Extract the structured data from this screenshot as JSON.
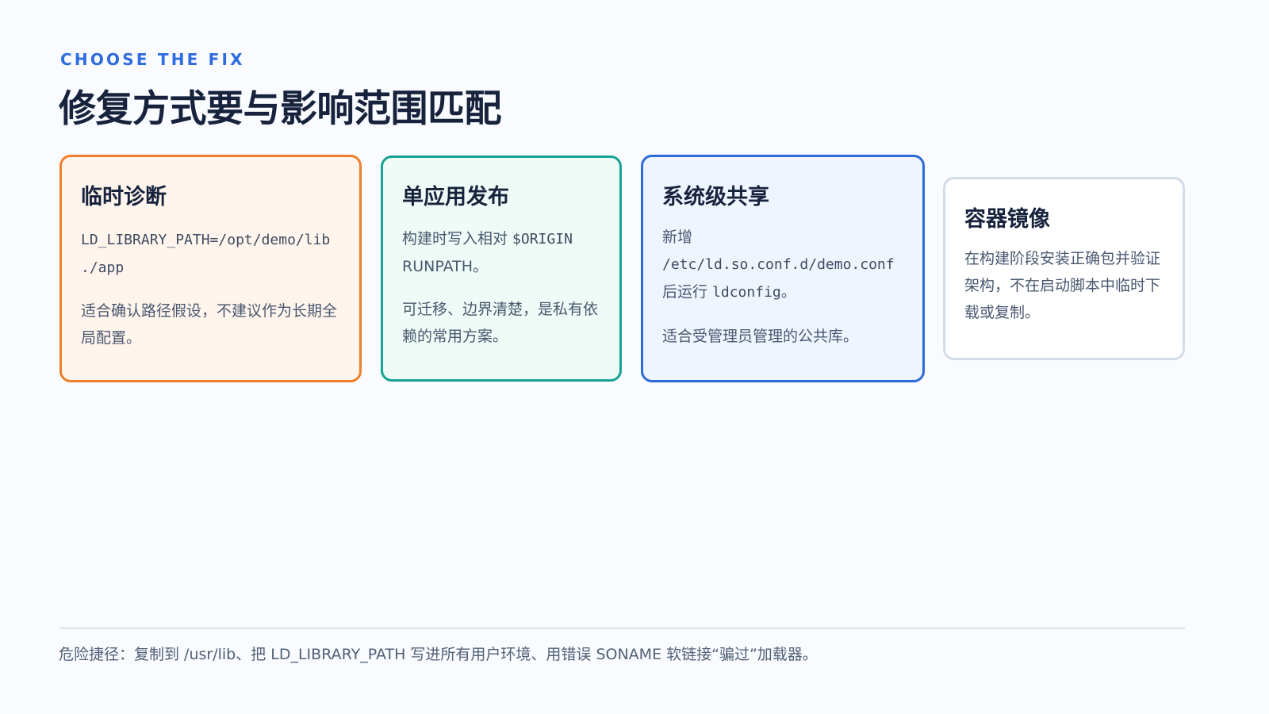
{
  "header": {
    "eyebrow": "CHOOSE THE FIX",
    "title": "修复方式要与影响范围匹配"
  },
  "cards": [
    {
      "title": "临时诊断",
      "cmd_line1": "LD_LIBRARY_PATH=/opt/demo/lib",
      "cmd_line2": "./app",
      "desc": "适合确认路径假设，不建议作为长期全局配置。",
      "accent": "#ef7f2a",
      "background": "#fff5ec"
    },
    {
      "title": "单应用发布",
      "desc1_prefix": "构建时写入相对 ",
      "desc1_code": "$ORIGIN",
      "desc1_suffix": " RUNPATH。",
      "desc2": "可迁移、边界清楚，是私有依赖的常用方案。",
      "accent": "#16a394",
      "background": "#eefbf6"
    },
    {
      "title": "系统级共享",
      "desc1_prefix": "新增 ",
      "desc1_code": "/etc/ld.so.conf.d/demo.conf",
      "desc1_mid": " 后运行 ",
      "desc1_code2": "ldconfig",
      "desc1_suffix": "。",
      "desc2": "适合受管理员管理的公共库。",
      "accent": "#2e6bd9",
      "background": "#eff5ff"
    },
    {
      "title": "容器镜像",
      "desc": "在构建阶段安装正确包并验证架构，不在启动脚本中临时下载或复制。",
      "accent": "#d3dde8",
      "background": "#ffffff"
    }
  ],
  "footer": {
    "note": "危险捷径：复制到 /usr/lib、把 LD_LIBRARY_PATH 写进所有用户环境、用错误 SONAME 软链接“骗过”加载器。"
  }
}
